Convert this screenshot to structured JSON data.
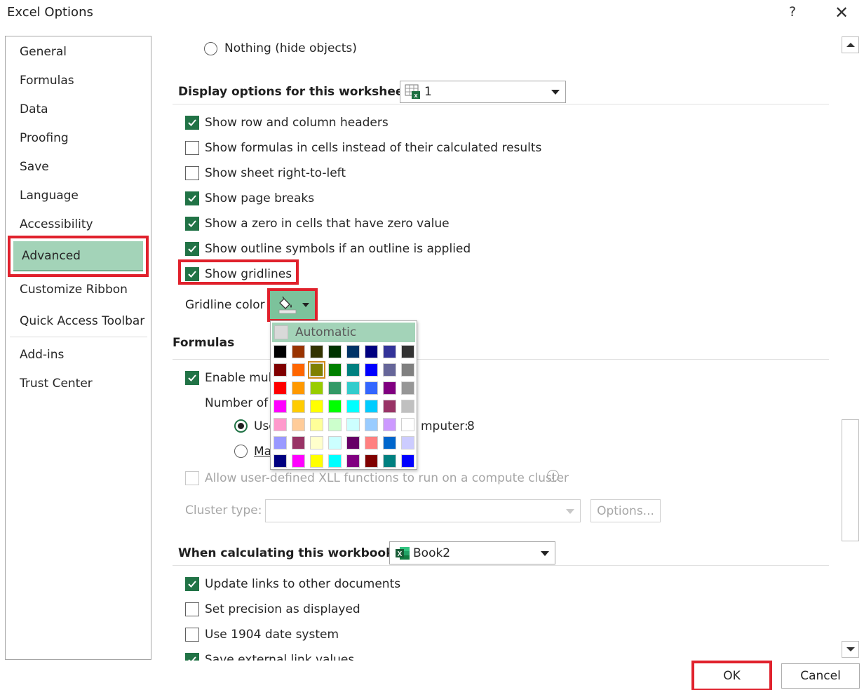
{
  "window": {
    "title": "Excel Options",
    "help_label": "?",
    "close_label": "✕"
  },
  "nav": {
    "items": [
      "General",
      "Formulas",
      "Data",
      "Proofing",
      "Save",
      "Language",
      "Accessibility",
      "Advanced",
      "Customize Ribbon",
      "Quick Access Toolbar",
      "Add-ins",
      "Trust Center"
    ],
    "selected": "Advanced"
  },
  "top": {
    "nothing_radio": "Nothing (hide objects)"
  },
  "display_worksheet": {
    "title": "Display options for this worksheet:",
    "sheet_value": "1",
    "options": [
      {
        "label": "Show row and column headers",
        "checked": true
      },
      {
        "label": "Show formulas in cells instead of their calculated results",
        "checked": false
      },
      {
        "label": "Show sheet right-to-left",
        "checked": false
      },
      {
        "label": "Show page breaks",
        "checked": true
      },
      {
        "label": "Show a zero in cells that have zero value",
        "checked": true
      },
      {
        "label": "Show outline symbols if an outline is applied",
        "checked": true
      },
      {
        "label": "Show gridlines",
        "checked": true
      }
    ],
    "gridline_color_label": "Gridline color"
  },
  "palette": {
    "automatic_label": "Automatic",
    "colors": [
      [
        "#000000",
        "#993300",
        "#333300",
        "#003300",
        "#003366",
        "#000080",
        "#333399",
        "#333333"
      ],
      [
        "#800000",
        "#FF6600",
        "#808000",
        "#008000",
        "#008080",
        "#0000FF",
        "#666699",
        "#808080"
      ],
      [
        "#FF0000",
        "#FF9900",
        "#99CC00",
        "#339966",
        "#33CCCC",
        "#3366FF",
        "#800080",
        "#969696"
      ],
      [
        "#FF00FF",
        "#FFCC00",
        "#FFFF00",
        "#00FF00",
        "#00FFFF",
        "#00CCFF",
        "#993366",
        "#C0C0C0"
      ],
      [
        "#FF99CC",
        "#FFCC99",
        "#FFFF99",
        "#CCFFCC",
        "#CCFFFF",
        "#99CCFF",
        "#CC99FF",
        "#FFFFFF"
      ],
      [
        "#9999FF",
        "#993366",
        "#FFFFCC",
        "#CCFFFF",
        "#660066",
        "#FF8080",
        "#0066CC",
        "#CCCCFF"
      ],
      [
        "#000080",
        "#FF00FF",
        "#FFFF00",
        "#00FFFF",
        "#800080",
        "#800000",
        "#008080",
        "#0000FF"
      ]
    ],
    "selected": [
      1,
      2
    ]
  },
  "formulas": {
    "title": "Formulas",
    "enable_multi_partial": "Enable mult",
    "number_of_partial": "Number of",
    "use_all_partial": "Use",
    "use_all_tail": "mputer:",
    "processor_count": "8",
    "manual_partial": "Ma",
    "allow_xll": "Allow user-defined XLL functions to run on a compute cluster",
    "cluster_type_label": "Cluster type:",
    "options_button": "Options..."
  },
  "calc_workbook": {
    "title": "When calculating this workbook:",
    "workbook_value": "Book2",
    "options": [
      {
        "label": "Update links to other documents",
        "checked": true
      },
      {
        "label": "Set precision as displayed",
        "checked": false
      },
      {
        "label": "Use 1904 date system",
        "checked": false
      },
      {
        "label": "Save external link values",
        "checked": true
      }
    ]
  },
  "footer": {
    "ok_label": "OK",
    "cancel_label": "Cancel"
  }
}
